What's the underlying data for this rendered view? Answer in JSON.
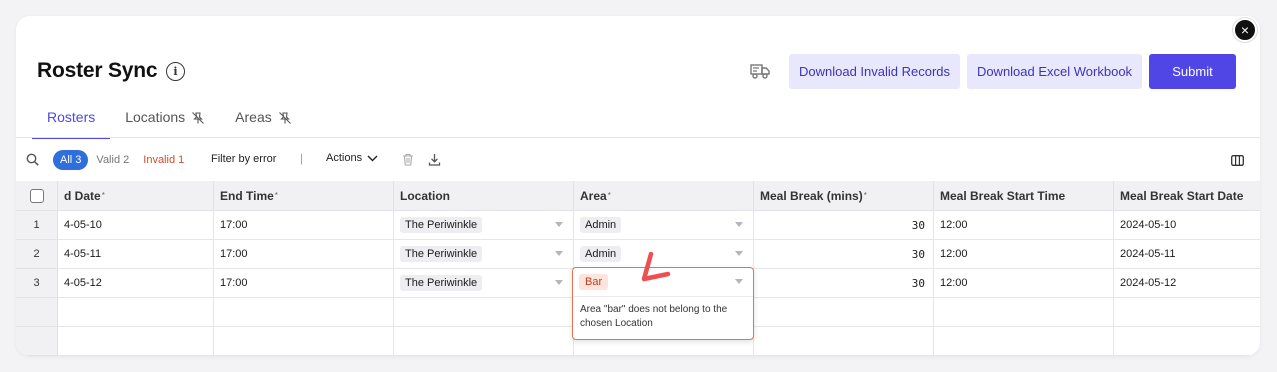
{
  "header": {
    "title": "Roster Sync",
    "download_invalid_label": "Download Invalid Records",
    "download_excel_label": "Download Excel Workbook",
    "submit_label": "Submit",
    "close_symbol": "×"
  },
  "tabs": [
    {
      "label": "Rosters",
      "active": true
    },
    {
      "label": "Locations",
      "icon": "pin-off-icon"
    },
    {
      "label": "Areas",
      "icon": "pin-off-icon"
    }
  ],
  "toolbar": {
    "filter_all_label": "All",
    "filter_all_count": "3",
    "filter_valid_label": "Valid",
    "filter_valid_count": "2",
    "filter_invalid_label": "Invalid",
    "filter_invalid_count": "1",
    "filter_by_error_label": "Filter by error",
    "separator": "|",
    "actions_label": "Actions"
  },
  "table": {
    "columns": [
      {
        "label": "d Date",
        "required": true
      },
      {
        "label": "End Time",
        "required": true
      },
      {
        "label": "Location",
        "required": false
      },
      {
        "label": "Area",
        "required": true
      },
      {
        "label": "Meal Break (mins)",
        "required": true
      },
      {
        "label": "Meal Break Start Time",
        "required": false
      },
      {
        "label": "Meal Break Start Date",
        "required": false
      }
    ],
    "required_marker": "*",
    "rows": [
      {
        "num": "1",
        "start_date": "4-05-10",
        "end_time": "17:00",
        "location": "The Periwinkle",
        "area": "Admin",
        "meal_break": "30",
        "meal_start_time": "12:00",
        "meal_start_date": "2024-05-10"
      },
      {
        "num": "2",
        "start_date": "4-05-11",
        "end_time": "17:00",
        "location": "The Periwinkle",
        "area": "Admin",
        "meal_break": "30",
        "meal_start_time": "12:00",
        "meal_start_date": "2024-05-11"
      },
      {
        "num": "3",
        "start_date": "4-05-12",
        "end_time": "17:00",
        "location": "The Periwinkle",
        "area": "Bar",
        "meal_break": "30",
        "meal_start_time": "12:00",
        "meal_start_date": "2024-05-12"
      }
    ],
    "error": {
      "value": "Bar",
      "message": "Area \"bar\" does not belong to the chosen Location"
    }
  },
  "colors": {
    "primary": "#4f46e5",
    "light_button": "#e8e7fc",
    "all_pill": "#2e6fdd",
    "invalid": "#d24d2c",
    "error_border": "#e0725a",
    "annotation": "#ef4f4f"
  }
}
